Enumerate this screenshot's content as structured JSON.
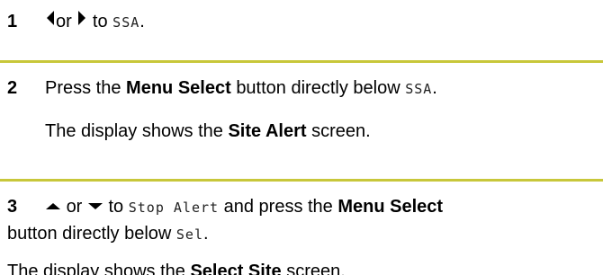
{
  "colors": {
    "separator": "#c8c73a",
    "text": "#000000"
  },
  "step1": {
    "number": "1",
    "icons": [
      "left-arrow-icon",
      "right-arrow-icon"
    ],
    "or": "or",
    "to": "to",
    "target": "SSA",
    "period": "."
  },
  "step2": {
    "number": "2",
    "press": "Press the",
    "menu_select": "Menu Select",
    "directly_below": "button directly below",
    "target": "SSA",
    "period": ".",
    "display_shows": "The display shows the",
    "screen_name": "Site Alert",
    "screen": "screen."
  },
  "step3": {
    "number": "3",
    "icons": [
      "up-arrow-icon",
      "down-arrow-icon"
    ],
    "or": "or",
    "to": "to",
    "target": "Stop Alert",
    "and_press": "and press the",
    "menu_select": "Menu Select",
    "directly_below": "button directly below",
    "sel": "Sel",
    "period": ".",
    "display_shows": "The display shows the",
    "screen_name": "Select Site",
    "screen": "screen."
  }
}
